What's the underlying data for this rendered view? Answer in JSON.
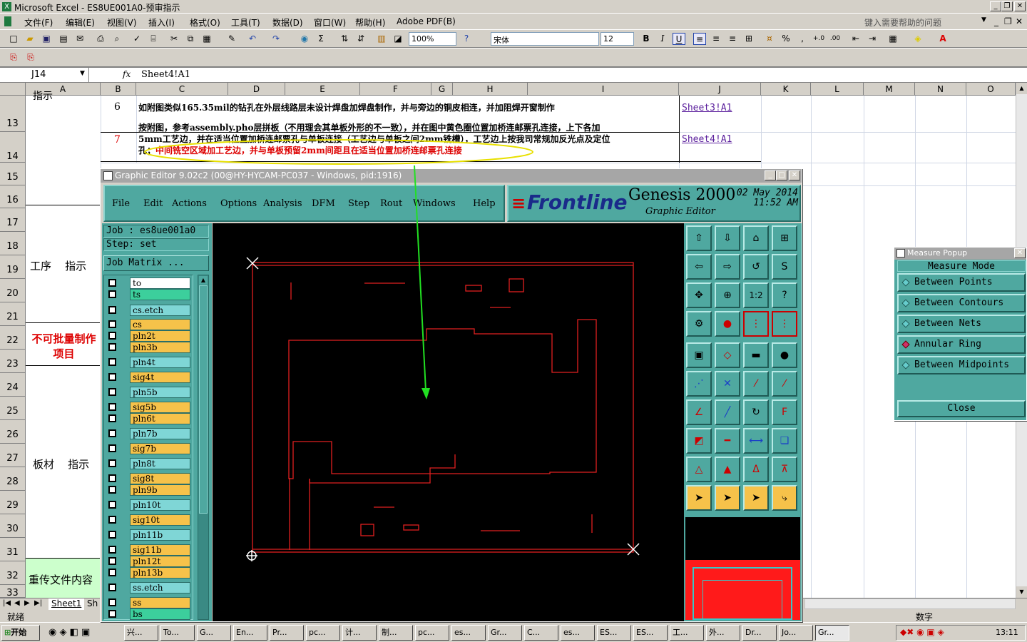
{
  "excel": {
    "title": "Microsoft Excel - ES8UE001A0-预审指示",
    "help_placeholder": "键入需要帮助的问题",
    "menu": [
      "文件(F)",
      "编辑(E)",
      "视图(V)",
      "插入(I)",
      "格式(O)",
      "工具(T)",
      "数据(D)",
      "窗口(W)",
      "帮助(H)",
      "Adobe PDF(B)"
    ],
    "zoom": "100%",
    "font": "宋体",
    "font_size": "12",
    "name_box": "J14",
    "fx": "fx",
    "formula": "Sheet4!A1",
    "columns": [
      "A",
      "B",
      "C",
      "D",
      "E",
      "F",
      "G",
      "H",
      "I",
      "J",
      "K",
      "L",
      "M",
      "N",
      "O"
    ],
    "rows": [
      "13",
      "14",
      "15",
      "16",
      "17",
      "18",
      "19",
      "20",
      "21",
      "22",
      "23",
      "24",
      "25",
      "26",
      "27",
      "28",
      "29",
      "30",
      "31",
      "32",
      "33"
    ],
    "cells": {
      "a12_partial": "指示",
      "b13": "6",
      "c13": "如附图类似165.35mil的钻孔在外层线路层未设计焊盘加焊盘制作，并与旁边的铜皮相连，并加阻焊开窗制作",
      "j13": "Sheet3!A1",
      "b14": "7",
      "c14_line1": "按附图，参考assembly.pho层拼板（不用理会其单板外形的不一致），并在图中黄色圈位置加桥连邮票孔连接，上下各加",
      "c14_line2": "5mm工艺边，并在适当位置加桥连邮票孔与单板连接（工艺边与单板之间2mm铣槽），工艺边上按我司常规加反光点及定位",
      "c14_line3_black": "孔；",
      "c14_line3_red": "中间铣空区域加工艺边，并与单板预留2mm间距且在适当位置加桥连邮票孔连接",
      "j14": "Sheet4!A1",
      "a19": "工序    指示",
      "a22": "不可批量制作项目",
      "a28": "板材    指示",
      "a32": "重传文件内容"
    },
    "sheet_tab": "Sheet1",
    "sheet_tab_partial": "Sh",
    "status_left": "就绪",
    "status_right": "数字",
    "taskbar": {
      "start": "开始",
      "tasks": [
        "兴...",
        "To...",
        "G...",
        "En...",
        "Pr...",
        "pc...",
        "计...",
        "制...",
        "pc...",
        "es...",
        "Gr...",
        "C...",
        "es...",
        "ES...",
        "ES...",
        "工...",
        "外...",
        "Dr...",
        "Jo...",
        "Gr..."
      ],
      "clock": "13:11"
    }
  },
  "genesis": {
    "title": "Graphic Editor 9.02c2 (00@HY-HYCAM-PC037 - Windows, pid:1916)",
    "menu": [
      "File",
      "Edit",
      "Actions",
      "Options",
      "Analysis",
      "DFM",
      "Step",
      "Rout",
      "Windows",
      "Help"
    ],
    "logo": "Frontline",
    "product": "Genesis 2000",
    "subtitle": "Graphic Editor",
    "date": "02 May 2014",
    "time": "11:52 AM",
    "job": "Job : es8ue001a0",
    "step": "Step: set",
    "job_matrix": "Job Matrix ...",
    "layers": [
      {
        "name": "to",
        "color": "#ffffff"
      },
      {
        "name": "ts",
        "color": "#3ccf9c"
      },
      {
        "name": "cs.etch",
        "color": "#7fd6d6"
      },
      {
        "name": "cs",
        "color": "#f6c24a"
      },
      {
        "name": "pln2t",
        "color": "#f6c24a"
      },
      {
        "name": "pln3b",
        "color": "#f6c24a"
      },
      {
        "name": "pln4t",
        "color": "#7fd6d6"
      },
      {
        "name": "sig4t",
        "color": "#f6c24a"
      },
      {
        "name": "pln5b",
        "color": "#7fd6d6"
      },
      {
        "name": "sig5b",
        "color": "#f6c24a"
      },
      {
        "name": "pln6t",
        "color": "#f6c24a"
      },
      {
        "name": "pln7b",
        "color": "#7fd6d6"
      },
      {
        "name": "sig7b",
        "color": "#f6c24a"
      },
      {
        "name": "pln8t",
        "color": "#7fd6d6"
      },
      {
        "name": "sig8t",
        "color": "#f6c24a"
      },
      {
        "name": "pln9b",
        "color": "#f6c24a"
      },
      {
        "name": "pln10t",
        "color": "#7fd6d6"
      },
      {
        "name": "sig10t",
        "color": "#f6c24a"
      },
      {
        "name": "pln11b",
        "color": "#7fd6d6"
      },
      {
        "name": "sig11b",
        "color": "#f6c24a"
      },
      {
        "name": "pln12t",
        "color": "#f6c24a"
      },
      {
        "name": "pln13b",
        "color": "#f6c24a"
      },
      {
        "name": "ss.etch",
        "color": "#7fd6d6"
      },
      {
        "name": "ss",
        "color": "#f6c24a"
      },
      {
        "name": "bs",
        "color": "#3ccf9c"
      }
    ]
  },
  "measure": {
    "title": "Measure Popup",
    "mode_label": "Measure Mode",
    "options": [
      "Between Points",
      "Between Contours",
      "Between Nets",
      "Annular Ring",
      "Between Midpoints"
    ],
    "selected": "Annular Ring",
    "close": "Close"
  }
}
